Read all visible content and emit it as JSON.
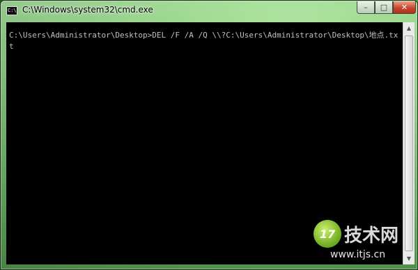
{
  "window": {
    "title": "C:\\Windows\\system32\\cmd.exe",
    "icon": "cmd-app-icon",
    "icon_glyph": "C:\\",
    "controls": {
      "minimize": "–",
      "maximize": "□",
      "close": "✕"
    }
  },
  "console": {
    "text": "C:\\Users\\Administrator\\Desktop>DEL /F /A /Q \\\\?C:\\Users\\Administrator\\Desktop\\地点.txt",
    "background": "#000000",
    "foreground": "#c0c0c0"
  },
  "scrollbar": {
    "up_glyph": "▲",
    "down_glyph": "▼"
  },
  "watermark": {
    "logo_text": "17",
    "name": "技术网",
    "url": "www.itjs.cn"
  }
}
